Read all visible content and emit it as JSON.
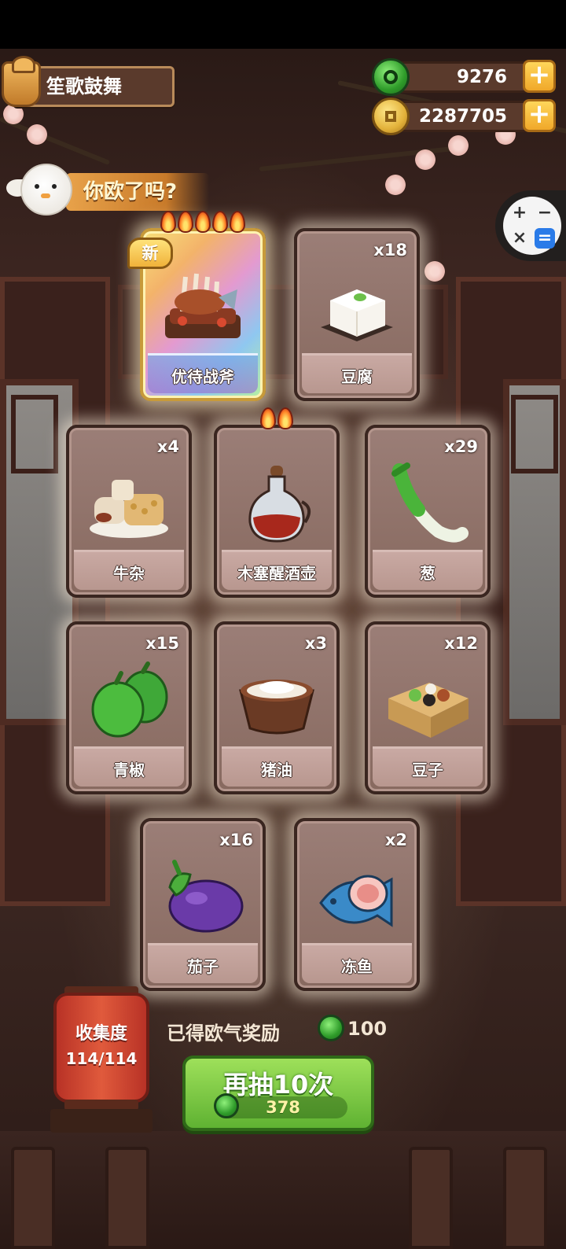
{
  "header": {
    "title": "笙歌鼓舞",
    "gems": "9276",
    "coins": "2287705"
  },
  "calculator": {
    "plus": "+",
    "minus": "−",
    "times": "×",
    "equals": "="
  },
  "banner": {
    "text": "你欧了吗?"
  },
  "cards": [
    {
      "name": "优待战斧",
      "count": "",
      "badge": "新",
      "flames": 5,
      "special": true,
      "icon": "meat-platter-icon"
    },
    {
      "name": "豆腐",
      "count": "x18",
      "flames": 0,
      "icon": "tofu-icon"
    },
    {
      "name": "牛杂",
      "count": "x4",
      "flames": 0,
      "icon": "beef-offal-icon"
    },
    {
      "name": "木塞醒酒壶",
      "count": "",
      "flames": 2,
      "icon": "decanter-icon"
    },
    {
      "name": "葱",
      "count": "x29",
      "flames": 0,
      "icon": "scallion-icon"
    },
    {
      "name": "青椒",
      "count": "x15",
      "flames": 0,
      "icon": "green-pepper-icon"
    },
    {
      "name": "猪油",
      "count": "x3",
      "flames": 0,
      "icon": "lard-icon"
    },
    {
      "name": "豆子",
      "count": "x12",
      "flames": 0,
      "icon": "beans-icon"
    },
    {
      "name": "茄子",
      "count": "x16",
      "flames": 0,
      "icon": "eggplant-icon"
    },
    {
      "name": "冻鱼",
      "count": "x2",
      "flames": 0,
      "icon": "frozen-fish-icon"
    }
  ],
  "collection": {
    "label": "收集度",
    "progress": "114/114"
  },
  "reward": {
    "label": "已得欧气奖励",
    "value": "100"
  },
  "draw_button": {
    "label": "再抽10次",
    "cost": "378"
  },
  "colors": {
    "accent_green": "#5fb232",
    "card_bg": "#9b7e77",
    "gold": "#f0b23a"
  }
}
